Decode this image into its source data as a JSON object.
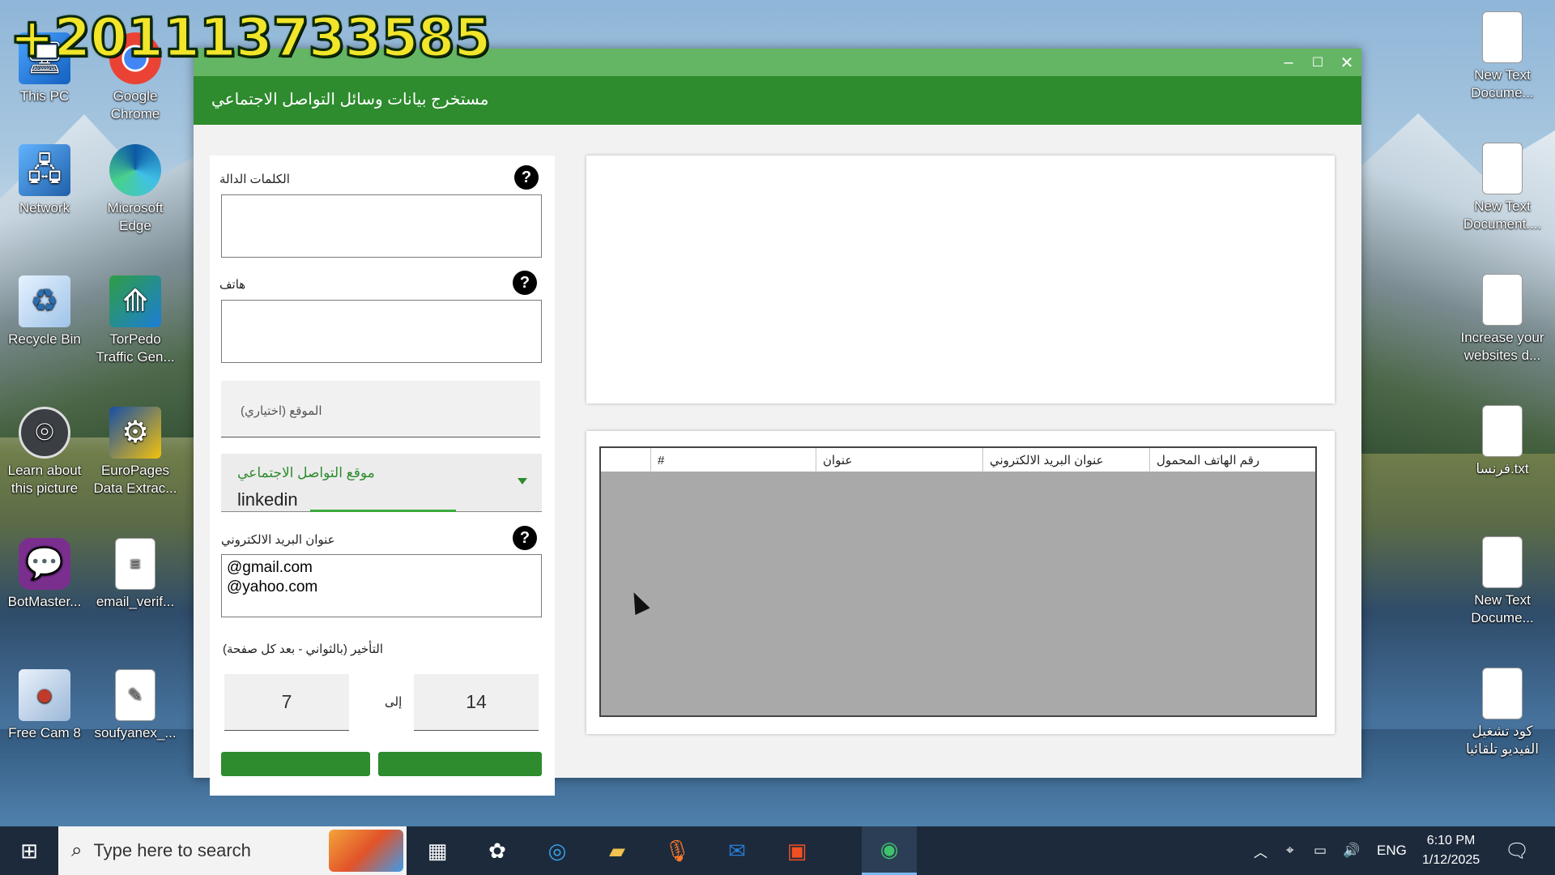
{
  "watermark": "+201113733585",
  "desktop": {
    "left_icons": [
      {
        "label": "This PC",
        "icon": "computer-icon"
      },
      {
        "label": "Google Chrome",
        "icon": "chrome-icon"
      },
      {
        "label": "Network",
        "icon": "network-icon"
      },
      {
        "label": "Microsoft Edge",
        "icon": "edge-icon"
      },
      {
        "label": "Recycle Bin",
        "icon": "recycle-bin-icon"
      },
      {
        "label": "TorPedo Traffic Gen...",
        "icon": "torpedo-icon"
      },
      {
        "label": "Learn about this picture",
        "icon": "camera-icon"
      },
      {
        "label": "EuroPages Data Extrac...",
        "icon": "europages-icon"
      },
      {
        "label": "BotMaster...",
        "icon": "chat-bubble-icon"
      },
      {
        "label": "email_verif...",
        "icon": "document-icon"
      },
      {
        "label": "Free Cam 8",
        "icon": "screen-recorder-icon"
      },
      {
        "label": "soufyanex_...",
        "icon": "notepad-icon"
      }
    ],
    "right_icons": [
      {
        "label": "New Text Docume...",
        "icon": "text-file-icon"
      },
      {
        "label": "New Text Document....",
        "icon": "text-file-icon"
      },
      {
        "label": "Increase your websites d...",
        "icon": "text-file-icon"
      },
      {
        "label": "فرنسا.txt",
        "icon": "text-file-icon"
      },
      {
        "label": "New Text Docume...",
        "icon": "text-file-icon"
      },
      {
        "label": "كود تشغيل الفيديو تلقائيا",
        "icon": "text-file-icon"
      }
    ]
  },
  "app": {
    "title": "مستخرج بيانات وسائل التواصل الاجتماعي",
    "window_buttons": {
      "minimize": "–",
      "maximize": "☐",
      "close": "✕"
    },
    "form": {
      "keywords_label": "الكلمات الدالة",
      "keywords_value": "",
      "phone_label": "هاتف",
      "phone_value": "",
      "location_placeholder": "الموقع (اختياري)",
      "social_site_label": "موقع التواصل الاجتماعي",
      "social_site_value": "linkedin",
      "email_label": "عنوان البريد الالكتروني",
      "email_value": "@gmail.com\n@yahoo.com",
      "delay_label": "التأخير (بالثواني - بعد كل صفحة)",
      "delay_from": "7",
      "delay_to_label": "إلى",
      "delay_to": "14",
      "help_glyph": "?"
    },
    "results_table": {
      "columns": [
        "#",
        "عنوان",
        "عنوان البريد الالكتروني",
        "رقم الهاتف المحمول"
      ],
      "rows": []
    }
  },
  "taskbar": {
    "search_placeholder": "Type here to search",
    "tray_language": "ENG",
    "time": "6:10 PM",
    "date": "1/12/2025"
  }
}
